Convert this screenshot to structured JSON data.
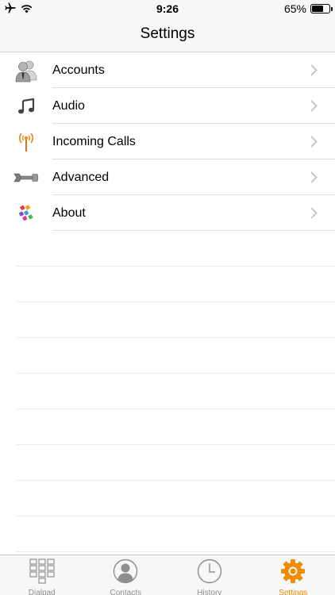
{
  "status_bar": {
    "time": "9:26",
    "battery_percent_text": "65%",
    "battery_level": 0.65
  },
  "nav": {
    "title": "Settings"
  },
  "settings_items": [
    {
      "label": "Accounts",
      "icon": "accounts-icon"
    },
    {
      "label": "Audio",
      "icon": "music-note-icon"
    },
    {
      "label": "Incoming Calls",
      "icon": "antenna-icon"
    },
    {
      "label": "Advanced",
      "icon": "wrench-icon"
    },
    {
      "label": "About",
      "icon": "app-logo-icon"
    }
  ],
  "tabs": [
    {
      "label": "Dialpad",
      "icon": "dialpad-icon",
      "active": false
    },
    {
      "label": "Contacts",
      "icon": "contacts-icon",
      "active": false
    },
    {
      "label": "History",
      "icon": "clock-icon",
      "active": false
    },
    {
      "label": "Settings",
      "icon": "gear-icon",
      "active": true
    }
  ],
  "colors": {
    "accent": "#f08c00",
    "inactive_tab": "#8e8e8e",
    "bar_background": "#f7f7f7"
  }
}
